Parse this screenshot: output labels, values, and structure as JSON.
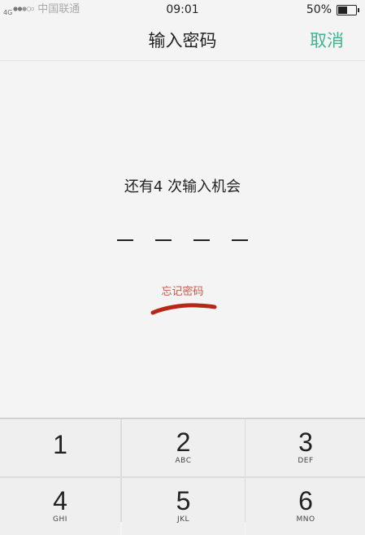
{
  "status_bar": {
    "network_type": "4G",
    "carrier": "中国联通",
    "time": "09:01",
    "battery_percent": "50%",
    "battery_level": 0.5
  },
  "nav": {
    "title": "输入密码",
    "cancel_label": "取消",
    "accent_color": "#3eb58f"
  },
  "prompt": {
    "attempts_text": "还有4 次输入机会",
    "pin_length": 4,
    "forgot_label": "忘记密码",
    "forgot_color": "#c45a4a"
  },
  "keypad": {
    "keys": [
      {
        "number": "1",
        "letters": ""
      },
      {
        "number": "2",
        "letters": "ABC"
      },
      {
        "number": "3",
        "letters": "DEF"
      },
      {
        "number": "4",
        "letters": "GHI"
      },
      {
        "number": "5",
        "letters": "JKL"
      },
      {
        "number": "6",
        "letters": "MNO"
      }
    ]
  }
}
